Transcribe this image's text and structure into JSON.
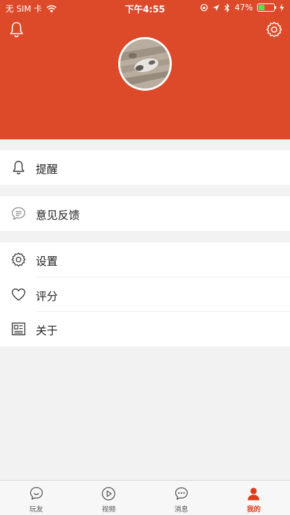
{
  "status_bar": {
    "carrier": "无 SIM 卡",
    "time": "下午4:55",
    "battery": "47%",
    "battery_level": 0.47
  },
  "menu": {
    "reminder": "提醒",
    "feedback": "意见反馈",
    "settings": "设置",
    "rating": "评分",
    "about": "关于"
  },
  "tabbar": {
    "items": [
      {
        "label": "玩友",
        "icon": "smile-chat-icon"
      },
      {
        "label": "视频",
        "icon": "play-circle-icon"
      },
      {
        "label": "消息",
        "icon": "message-bubble-icon"
      },
      {
        "label": "我的",
        "icon": "person-icon",
        "active": true
      }
    ]
  },
  "colors": {
    "brand": "#dd4a2a",
    "active_tab": "#dd3b1a",
    "background": "#f2f2f2"
  }
}
